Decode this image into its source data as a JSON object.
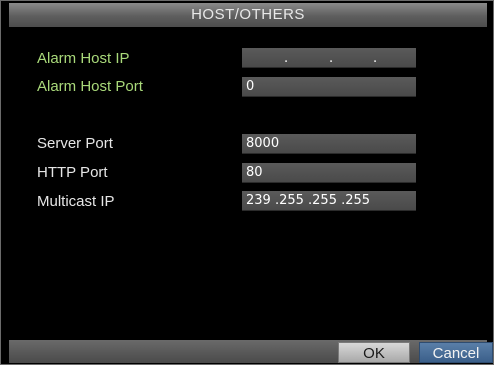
{
  "window": {
    "title": "HOST/OTHERS"
  },
  "fields": {
    "alarm_host_ip": {
      "label": "Alarm Host IP",
      "value": ""
    },
    "alarm_host_port": {
      "label": "Alarm Host Port",
      "value": "0"
    },
    "server_port": {
      "label": "Server Port",
      "value": "8000"
    },
    "http_port": {
      "label": "HTTP Port",
      "value": "80"
    },
    "multicast_ip": {
      "label": "Multicast IP",
      "value": "239 .255 .255 .255"
    }
  },
  "buttons": {
    "ok_label": "OK",
    "cancel_label": "Cancel"
  },
  "colors": {
    "label_highlight": "#a9d97a",
    "label_normal": "#e6e6e6",
    "cancel_selected": "#3b5f8a"
  }
}
